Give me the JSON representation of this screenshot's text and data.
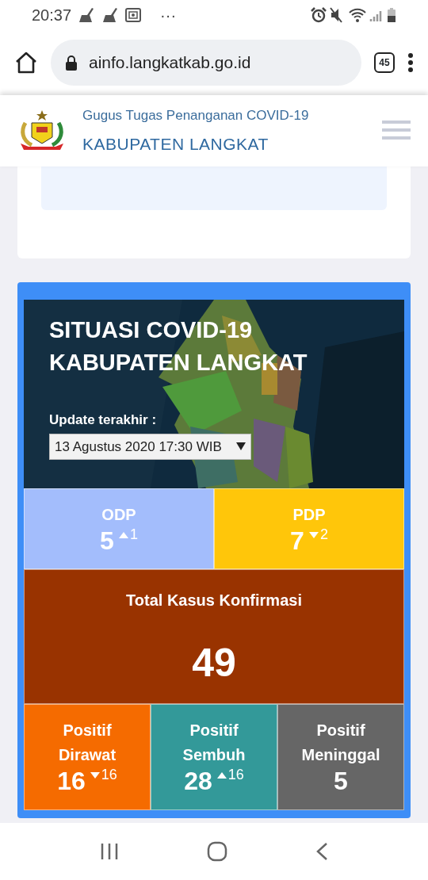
{
  "status_bar": {
    "time": "20:37",
    "more": "···"
  },
  "browser": {
    "url": "ainfo.langkatkab.go.id",
    "tab_count": "45"
  },
  "site_header": {
    "subtitle": "Gugus Tugas Penanganan COVID-19",
    "title": "KABUPATEN LANGKAT"
  },
  "dashboard": {
    "title_lines": [
      "SITUASI COVID-19",
      "KABUPATEN LANGKAT"
    ],
    "update_label": "Update terakhir :",
    "update_select": {
      "value": "13 Agustus 2020 17:30 WIB"
    },
    "suspect_tiles": [
      {
        "label_lines": [
          "ODP"
        ],
        "value": "5",
        "change": "1",
        "kind": "up",
        "color": "#a3bdfc"
      },
      {
        "label_lines": [
          "PDP"
        ],
        "value": "7",
        "change": "2",
        "kind": "down",
        "color": "#ffc60a"
      }
    ],
    "total_tile": {
      "label_lines": [
        "Total Kasus Konfirmasi"
      ],
      "value": "49",
      "kind": "total",
      "color": "#993300"
    },
    "positive_tiles": [
      {
        "label_lines": [
          "Positif",
          "Dirawat"
        ],
        "value": "16",
        "change": "16",
        "kind": "down",
        "color": "#f56b00"
      },
      {
        "label_lines": [
          "Positif",
          "Sembuh"
        ],
        "value": "28",
        "change": "16",
        "kind": "up",
        "color": "#339999"
      },
      {
        "label_lines": [
          "Positif",
          "Meninggal"
        ],
        "value": "5",
        "kind": "none",
        "color": "#666666"
      }
    ]
  }
}
